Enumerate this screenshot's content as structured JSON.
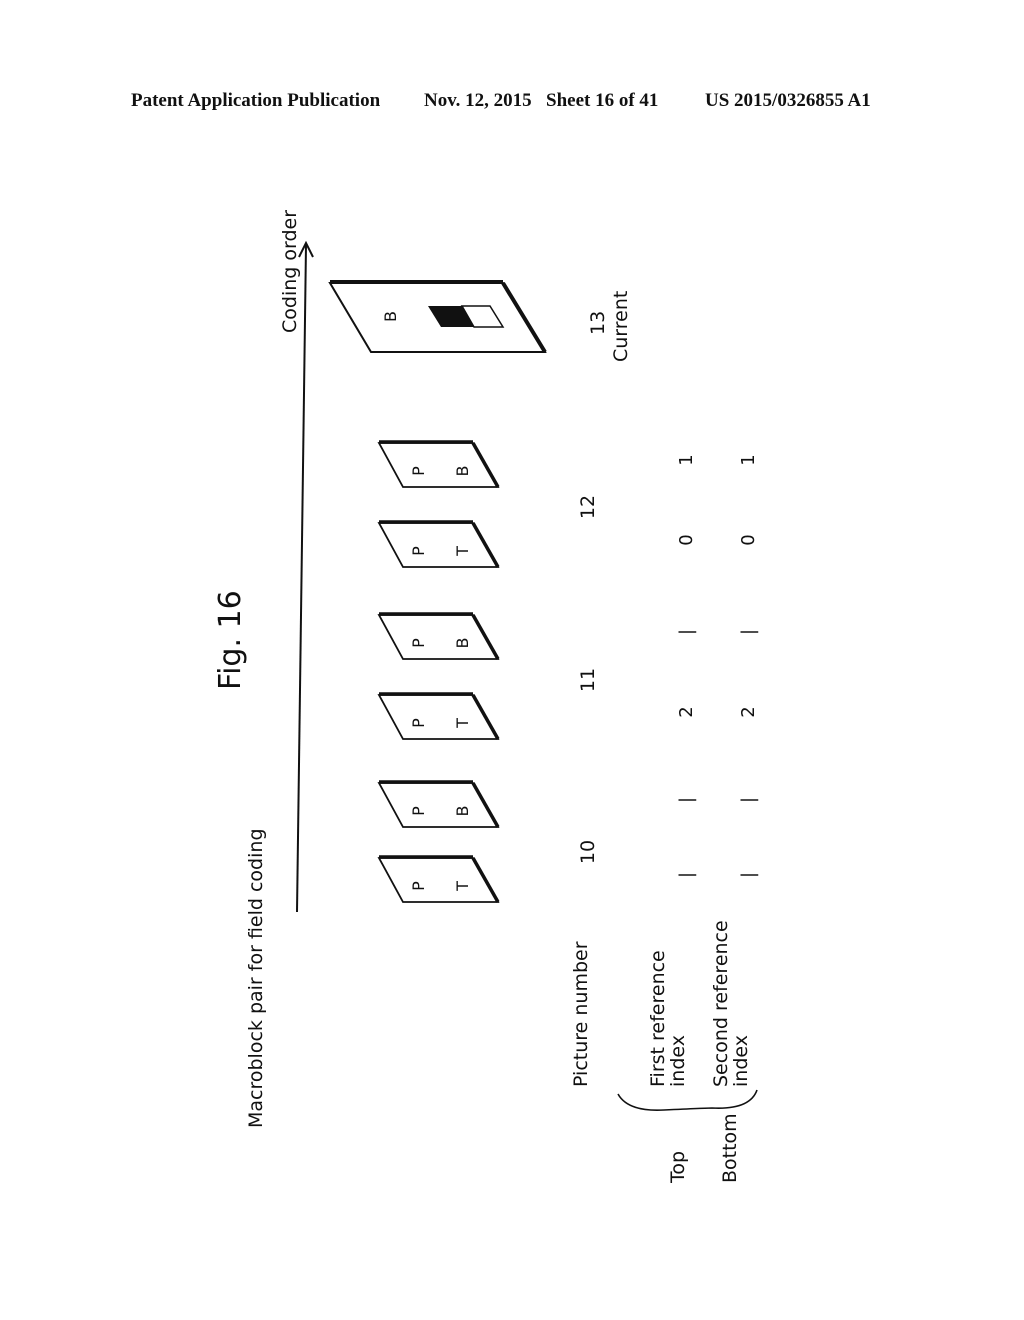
{
  "header": {
    "publication": "Patent Application Publication",
    "date": "Nov. 12, 2015",
    "sheet": "Sheet 16 of 41",
    "number": "US 2015/0326855 A1"
  },
  "figure": {
    "title": "Fig. 16",
    "caption_left": "Macroblock pair for field coding",
    "axis_label": "Coding order",
    "current_label": "Current",
    "row_labels": {
      "picture_number": "Picture number",
      "first_reference": [
        "First reference",
        "index"
      ],
      "second_reference": [
        "Second reference",
        "index"
      ],
      "top": "Top",
      "bottom": "Bottom"
    },
    "pictures": [
      {
        "number": "10",
        "fields": [
          {
            "type": "P",
            "parity": "T",
            "first_ref": "-",
            "second_ref": "-"
          },
          {
            "type": "P",
            "parity": "B",
            "first_ref": "-",
            "second_ref": "-"
          }
        ]
      },
      {
        "number": "11",
        "fields": [
          {
            "type": "P",
            "parity": "T",
            "first_ref": "2",
            "second_ref": "2"
          },
          {
            "type": "P",
            "parity": "B",
            "first_ref": "-",
            "second_ref": "-"
          }
        ]
      },
      {
        "number": "12",
        "fields": [
          {
            "type": "P",
            "parity": "T",
            "first_ref": "0",
            "second_ref": "0"
          },
          {
            "type": "P",
            "parity": "B",
            "first_ref": "1",
            "second_ref": "1"
          }
        ]
      }
    ],
    "current_picture": {
      "number": "13",
      "type": "B"
    }
  }
}
